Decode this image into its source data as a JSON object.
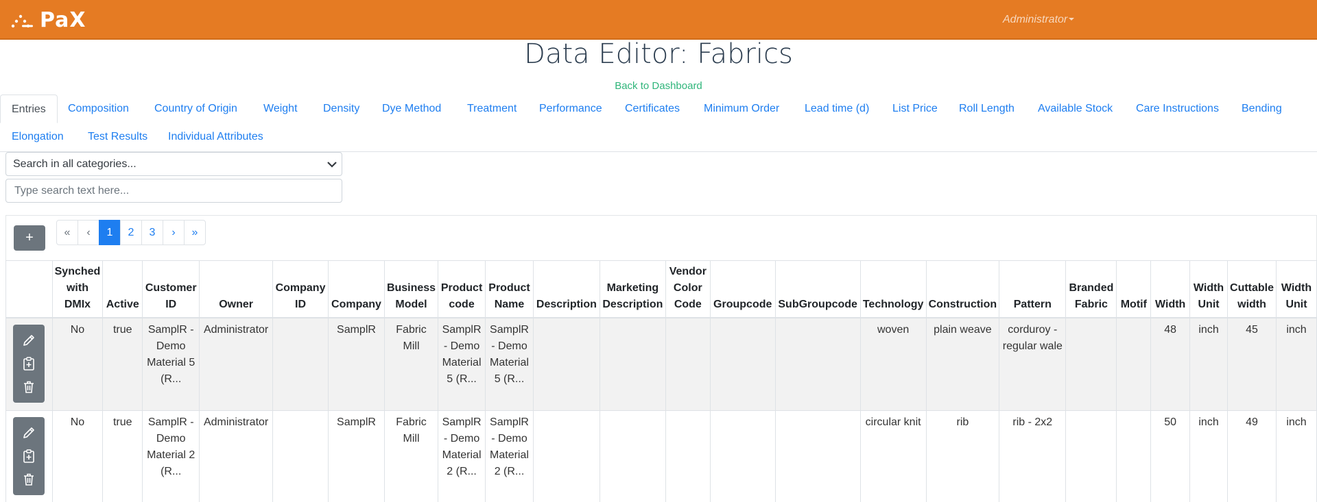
{
  "app": {
    "brand": "PaX",
    "user_menu": "Administrator"
  },
  "page": {
    "title": "Data Editor: Fabrics",
    "back_link": "Back to Dashboard"
  },
  "tabs": [
    "Entries",
    "Composition",
    "Country of Origin",
    "Weight",
    "Density",
    "Dye Method",
    "Treatment",
    "Performance",
    "Certificates",
    "Minimum Order",
    "Lead time (d)",
    "List Price",
    "Roll Length",
    "Available Stock",
    "Care Instructions",
    "Bending",
    "Elongation",
    "Test Results",
    "Individual Attributes"
  ],
  "active_tab": "Entries",
  "search": {
    "category_selected": "Search in all categories...",
    "placeholder": "Type search text here..."
  },
  "toolbar": {
    "add_label": "+"
  },
  "pagination": {
    "items": [
      "«",
      "‹",
      "1",
      "2",
      "3",
      "›",
      "»"
    ],
    "active": "1"
  },
  "table": {
    "columns": [
      "",
      "Synched with DMIx",
      "Active",
      "Customer ID",
      "Owner",
      "Company ID",
      "Company",
      "Business Model",
      "Product code",
      "Product Name",
      "Description",
      "Marketing Description",
      "Vendor Color Code",
      "Groupcode",
      "SubGroupcode",
      "Technology",
      "Construction",
      "Pattern",
      "Branded Fabric",
      "Motif",
      "Width",
      "Width Unit",
      "Cuttable width",
      "Width Unit"
    ],
    "rows": [
      [
        "",
        "No",
        "true",
        "SamplR - Demo Material 5 (R...",
        "Administrator",
        "",
        "SamplR",
        "Fabric Mill",
        "SamplR - Demo Material 5 (R...",
        "SamplR - Demo Material 5 (R...",
        "",
        "",
        "",
        "",
        "",
        "woven",
        "plain weave",
        "corduroy - regular wale",
        "",
        "",
        "48",
        "inch",
        "45",
        "inch"
      ],
      [
        "",
        "No",
        "true",
        "SamplR - Demo Material 2 (R...",
        "Administrator",
        "",
        "SamplR",
        "Fabric Mill",
        "SamplR - Demo Material 2 (R...",
        "SamplR - Demo Material 2 (R...",
        "",
        "",
        "",
        "",
        "",
        "circular knit",
        "rib",
        "rib - 2x2",
        "",
        "",
        "50",
        "inch",
        "49",
        "inch"
      ]
    ]
  },
  "colors": {
    "navbar": "#e57b23",
    "link": "#1e7ef0",
    "back_link": "#2fb57a",
    "action_button": "#6c757d"
  }
}
